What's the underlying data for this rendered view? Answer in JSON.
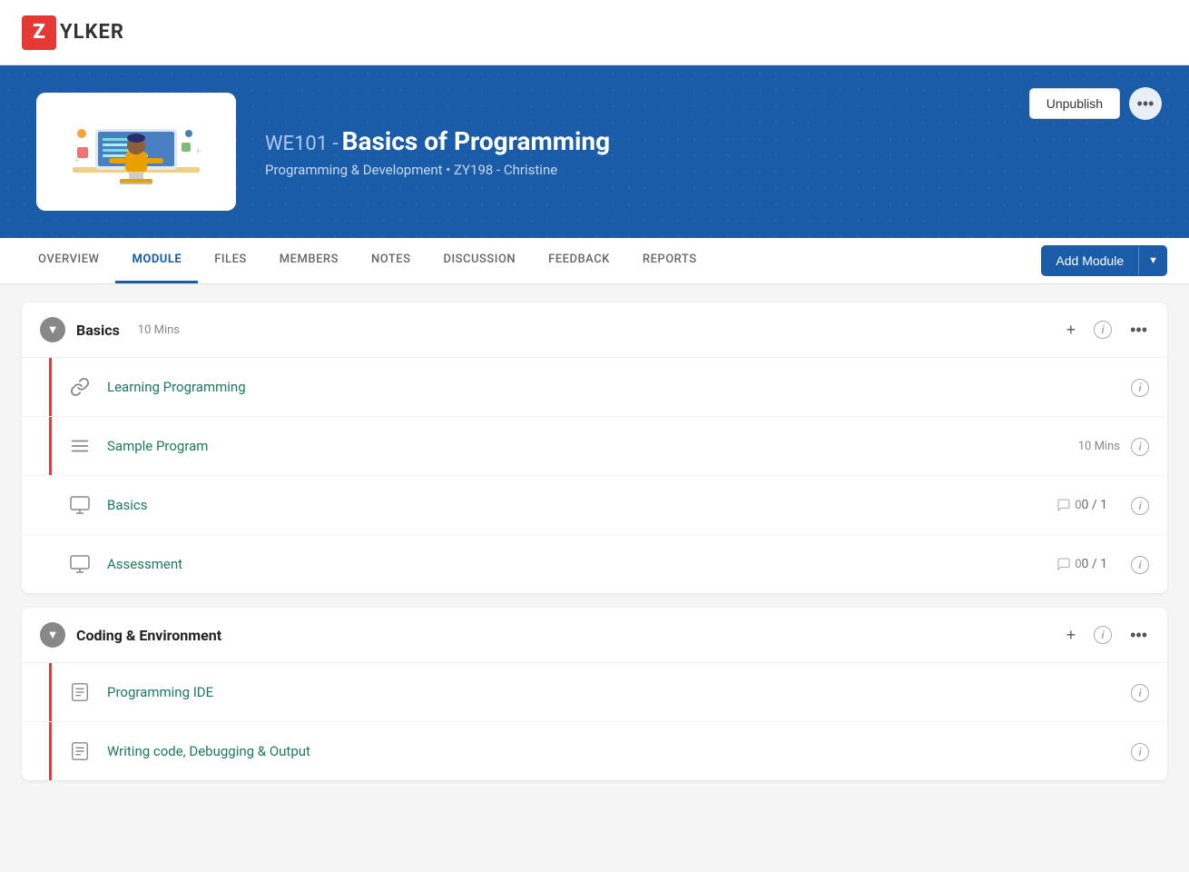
{
  "app": {
    "logo_letter": "Z",
    "logo_name": "YLKER"
  },
  "banner": {
    "course_code": "WE101  -",
    "course_title": "Basics of Programming",
    "subtitle": "Programming & Development  •  ZY198 - Christine",
    "unpublish_label": "Unpublish"
  },
  "nav": {
    "tabs": [
      {
        "id": "overview",
        "label": "OVERVIEW",
        "active": false
      },
      {
        "id": "module",
        "label": "MODULE",
        "active": true
      },
      {
        "id": "files",
        "label": "FILES",
        "active": false
      },
      {
        "id": "members",
        "label": "MEMBERS",
        "active": false
      },
      {
        "id": "notes",
        "label": "NOTES",
        "active": false
      },
      {
        "id": "discussion",
        "label": "DISCUSSION",
        "active": false
      },
      {
        "id": "feedback",
        "label": "FEEDBACK",
        "active": false
      },
      {
        "id": "reports",
        "label": "REPORTS",
        "active": false
      }
    ],
    "add_module_label": "Add Module"
  },
  "modules": [
    {
      "id": "basics",
      "title": "Basics",
      "duration": "10 Mins",
      "items": [
        {
          "id": "learning-programming",
          "icon": "link",
          "title": "Learning Programming",
          "duration": null,
          "score": null,
          "comments": null
        },
        {
          "id": "sample-program",
          "icon": "lines",
          "title": "Sample Program",
          "duration": "10 Mins",
          "score": null,
          "comments": null
        },
        {
          "id": "basics-item",
          "icon": "monitor",
          "title": "Basics",
          "duration": null,
          "score": "0 / 1",
          "comments": "0"
        },
        {
          "id": "assessment",
          "icon": "monitor",
          "title": "Assessment",
          "duration": null,
          "score": "0 / 1",
          "comments": "0"
        }
      ]
    },
    {
      "id": "coding-environment",
      "title": "Coding & Environment",
      "duration": null,
      "items": [
        {
          "id": "programming-ide",
          "icon": "doc",
          "title": "Programming IDE",
          "duration": null,
          "score": null,
          "comments": null
        },
        {
          "id": "writing-code",
          "icon": "doc",
          "title": "Writing code, Debugging & Output",
          "duration": null,
          "score": null,
          "comments": null
        }
      ]
    }
  ]
}
